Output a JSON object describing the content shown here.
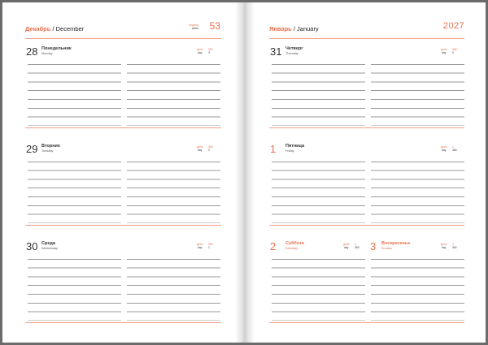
{
  "left_page": {
    "month_ru": "Декабрь",
    "month_en": " / December",
    "week_label_ru": "неделя",
    "week_label_en": "week",
    "week_number": "53",
    "days": [
      {
        "number": "28",
        "name_ru": "Понедельник",
        "name_en": "Monday",
        "day_label_ru": "день",
        "day_label_en": "day",
        "day_of_year": "362",
        "days_left": "3"
      },
      {
        "number": "29",
        "name_ru": "Вторник",
        "name_en": "Tuesday",
        "day_label_ru": "день",
        "day_label_en": "day",
        "day_of_year": "363",
        "days_left": "2"
      },
      {
        "number": "30",
        "name_ru": "Среда",
        "name_en": "Wednesday",
        "day_label_ru": "день",
        "day_label_en": "day",
        "day_of_year": "364",
        "days_left": "1"
      }
    ]
  },
  "right_page": {
    "month_ru": "Январь",
    "month_en": " / January",
    "year": "2027",
    "days": [
      {
        "number": "31",
        "name_ru": "Четверг",
        "name_en": "Thursday",
        "day_label_ru": "день",
        "day_label_en": "day",
        "day_of_year": "365",
        "days_left": "0"
      },
      {
        "number": "1",
        "name_ru": "Пятница",
        "name_en": "Friday",
        "day_label_ru": "день",
        "day_label_en": "day",
        "day_of_year": "1",
        "days_left": "364"
      },
      {
        "number": "2",
        "name_ru": "Суббота",
        "name_en": "Saturday",
        "day_label_ru": "день",
        "day_label_en": "day",
        "day_of_year": "2",
        "days_left": "363"
      },
      {
        "number": "3",
        "name_ru": "Воскресенье",
        "name_en": "Sunday",
        "day_label_ru": "день",
        "day_label_en": "day",
        "day_of_year": "3",
        "days_left": "362"
      }
    ]
  },
  "colors": {
    "accent": "#e8714d",
    "rule": "#9a9a9a",
    "border": "#6b6b6b"
  }
}
